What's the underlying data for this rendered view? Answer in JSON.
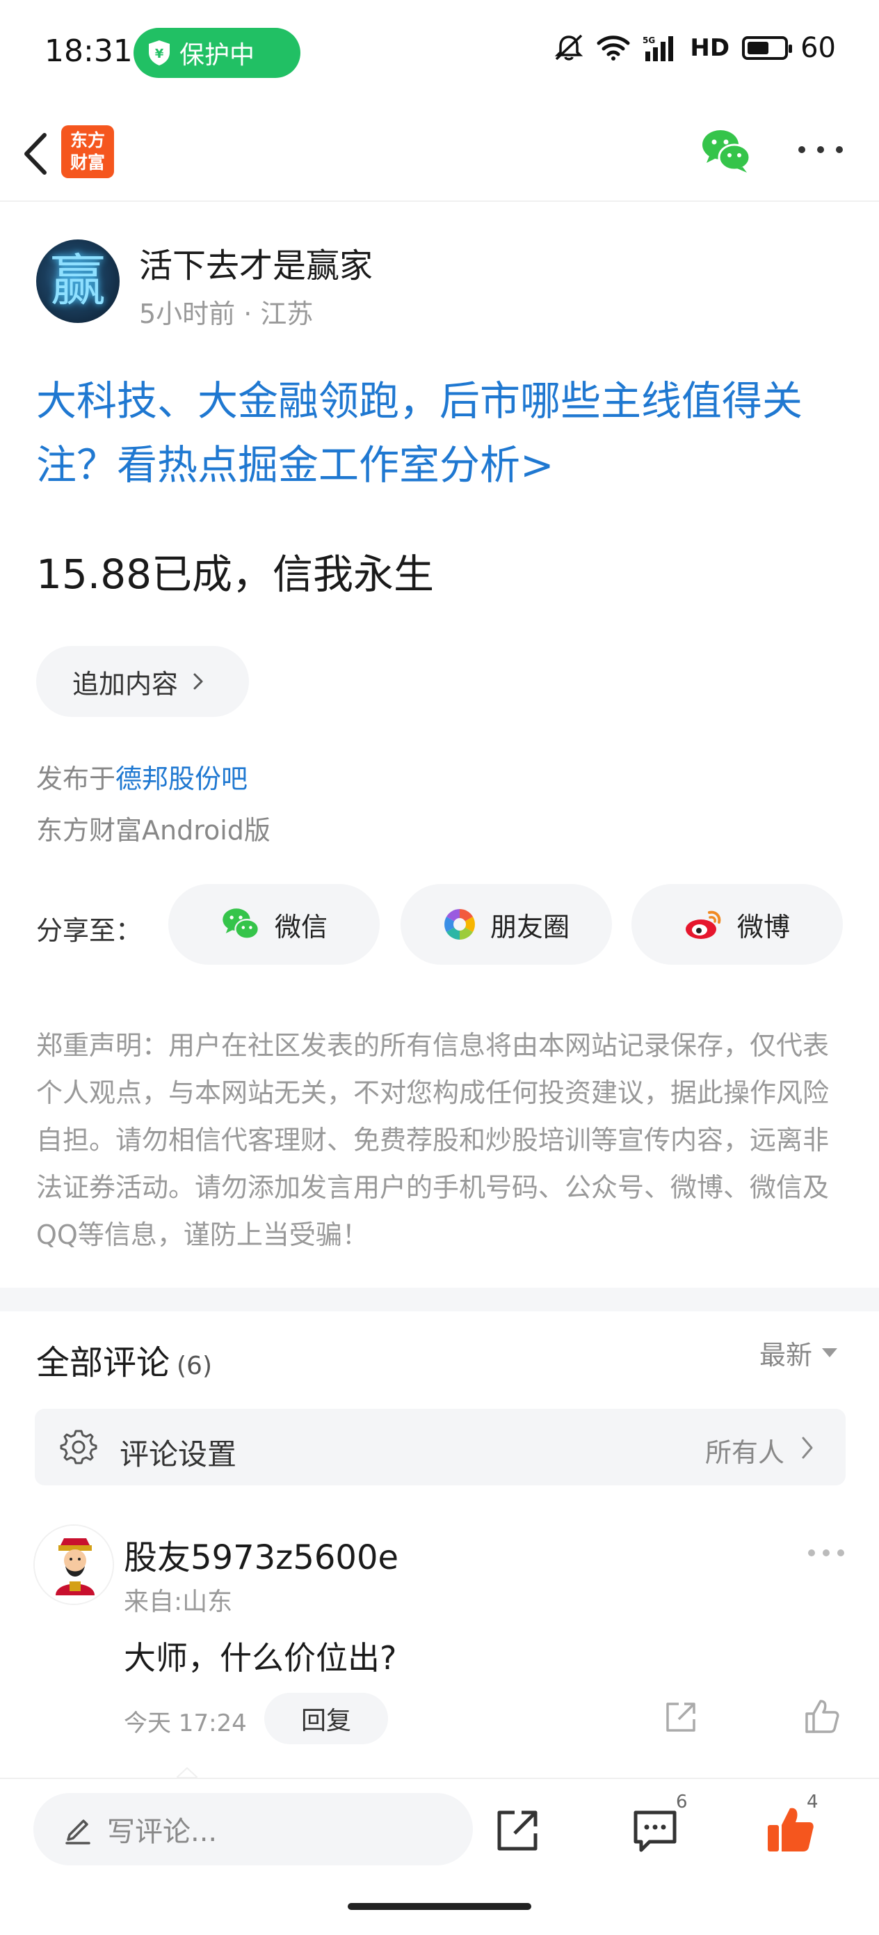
{
  "status_bar": {
    "time": "18:31",
    "protect_label": "保护中",
    "network": "HD",
    "battery": "60",
    "battery_level": 0.6
  },
  "nav": {
    "logo_line1": "东方",
    "logo_line2": "财富"
  },
  "post": {
    "author_avatar_glyph": "赢",
    "author_name": "活下去才是赢家",
    "meta": "5小时前 · 江苏",
    "promo_link": "大科技、大金融领跑，后市哪些主线值得关注？看热点掘金工作室分析>",
    "body": "15.88已成，信我永生",
    "append_label": "追加内容",
    "publish_prefix": "发布于",
    "publish_bar": "德邦股份吧",
    "client": "东方财富Android版"
  },
  "share": {
    "label": "分享至：",
    "wechat": "微信",
    "moments": "朋友圈",
    "weibo": "微博"
  },
  "disclaimer": "郑重声明：用户在社区发表的所有信息将由本网站记录保存，仅代表个人观点，与本网站无关，不对您构成任何投资建议，据此操作风险自担。请勿相信代客理财、免费荐股和炒股培训等宣传内容，远离非法证券活动。请勿添加发言用户的手机号码、公众号、微博、微信及QQ等信息，谨防上当受骗！",
  "comments": {
    "title": "全部评论",
    "count": "(6)",
    "sort": "最新",
    "settings_label": "评论设置",
    "settings_value": "所有人",
    "items": [
      {
        "author": "股友5973z5600e",
        "location": "来自:山东",
        "text": "大师，什么价位出?",
        "time": "今天 17:24",
        "reply_label": "回复"
      }
    ]
  },
  "toolbar": {
    "write_placeholder": "写评论...",
    "comment_count": "6",
    "like_count": "4"
  },
  "colors": {
    "link_blue": "#1f78d1",
    "protect_green": "#21c064",
    "brand_orange": "#f5561e",
    "like_orange": "#f5561e"
  }
}
